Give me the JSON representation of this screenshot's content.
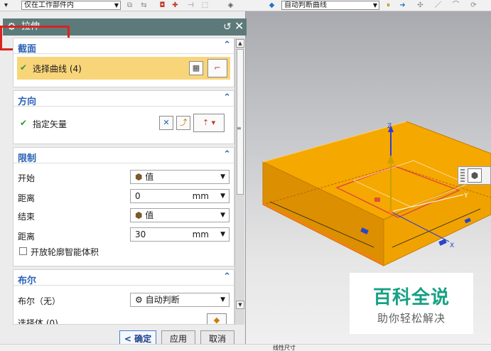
{
  "toolbar": {
    "selection_scope": "仅在工作部件内",
    "curve_rule": "自动判断曲线"
  },
  "dialog": {
    "title": "拉伸",
    "sections": {
      "section": {
        "title": "截面",
        "select_curve": "选择曲线 (4)"
      },
      "direction": {
        "title": "方向",
        "specify_vector": "指定矢量"
      },
      "limits": {
        "title": "限制",
        "start_label": "开始",
        "start_value": "值",
        "distance1_label": "距离",
        "distance1_value": "0",
        "distance1_unit": "mm",
        "end_label": "结束",
        "end_value": "值",
        "distance2_label": "距离",
        "distance2_value": "30",
        "distance2_unit": "mm",
        "open_profile_label": "开放轮廓智能体积",
        "open_profile_checked": false
      },
      "boolean": {
        "title": "布尔",
        "label": "布尔（无）",
        "value": "自动判断",
        "select_body_partial": "选择体 (0)"
      }
    },
    "buttons": {
      "ok": "< 确定 >",
      "apply": "应用",
      "cancel": "取消"
    }
  },
  "viewport": {
    "axis_labels": {
      "x": "X",
      "y": "Y",
      "z": "Z"
    },
    "body_color": "#f5a800"
  },
  "watermark": {
    "title": "百科全说",
    "subtitle": "助你轻松解决"
  },
  "status_bar": {
    "text": "线性尺寸"
  }
}
